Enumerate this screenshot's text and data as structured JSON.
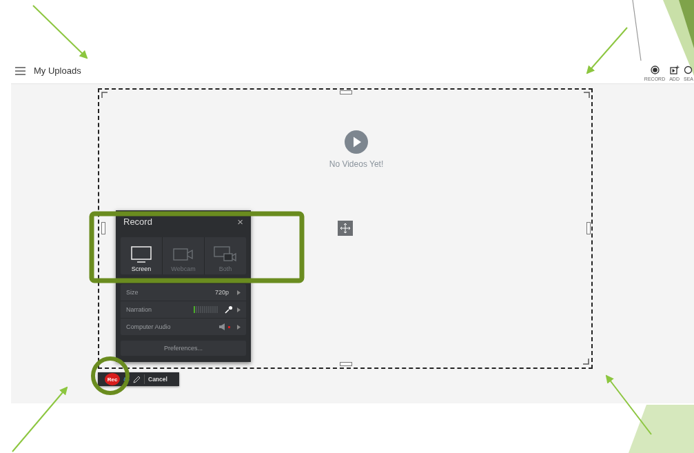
{
  "header": {
    "title": "My Uploads"
  },
  "toolbar": [
    {
      "kind": "record",
      "label": "RECORD"
    },
    {
      "kind": "add",
      "label": "ADD"
    },
    {
      "kind": "search",
      "label": "SEA"
    }
  ],
  "empty_state": {
    "message": "No Videos Yet!"
  },
  "record_panel": {
    "title": "Record",
    "close": "×",
    "sources": [
      {
        "kind": "screen",
        "label": "Screen",
        "selected": true
      },
      {
        "kind": "webcam",
        "label": "Webcam",
        "selected": false
      },
      {
        "kind": "both",
        "label": "Both",
        "selected": false
      }
    ],
    "settings": [
      {
        "kind": "size",
        "label": "Size",
        "value": "720p"
      },
      {
        "kind": "narration",
        "label": "Narration",
        "level": 0.08
      },
      {
        "kind": "audio",
        "label": "Computer Audio",
        "muted": true
      }
    ],
    "preferences": "Preferences..."
  },
  "capture_bar": {
    "record": "Rec",
    "cancel": "Cancel"
  }
}
